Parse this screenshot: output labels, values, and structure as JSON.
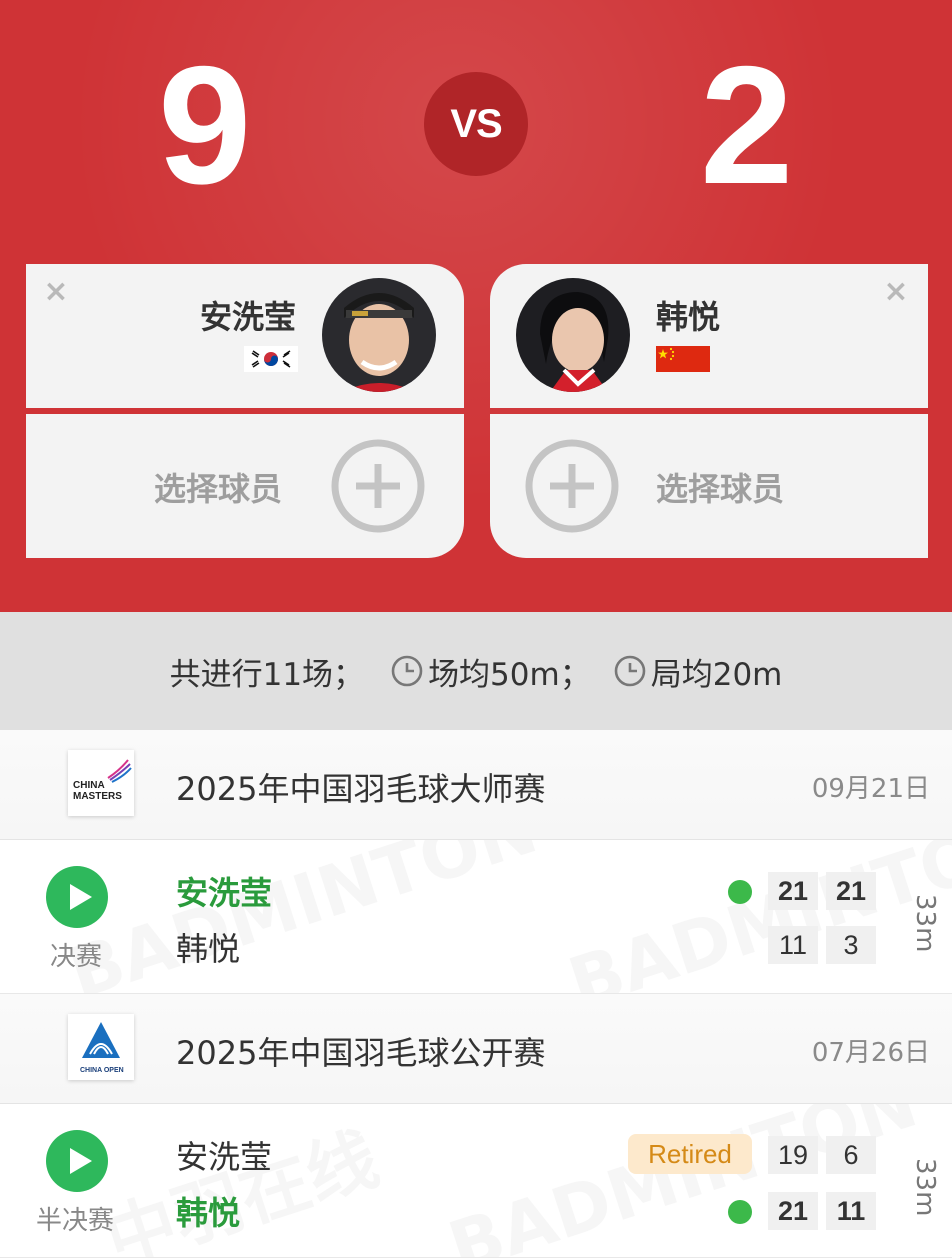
{
  "header": {
    "score_left": "9",
    "score_right": "2",
    "vs_label": "VS",
    "player1": {
      "name": "安洗莹",
      "flag": "korea-flag"
    },
    "player2": {
      "name": "韩悦",
      "flag": "china-flag"
    },
    "select_label_left": "选择球员",
    "select_label_right": "选择球员",
    "close_symbol": "×"
  },
  "stats": {
    "total": "共进行11场；",
    "avg_match": "场均50m；",
    "avg_game": "局均20m"
  },
  "events": [
    {
      "title": "2025年中国羽毛球大师赛",
      "date": "09月21日",
      "logo_text_1": "CHINA",
      "logo_text_2": "MASTERS",
      "match": {
        "round": "决赛",
        "player1": "安洗莹",
        "player2": "韩悦",
        "winner": 1,
        "scores1": [
          "21",
          "21"
        ],
        "scores2": [
          "11",
          "3"
        ],
        "duration": "33m"
      }
    },
    {
      "title": "2025年中国羽毛球公开赛",
      "date": "07月26日",
      "logo_text_1": "CHINA OPEN",
      "match": {
        "round": "半决赛",
        "player1": "安洗莹",
        "player2": "韩悦",
        "winner": 2,
        "retired_label": "Retired",
        "scores1": [
          "19",
          "6"
        ],
        "scores2": [
          "21",
          "11"
        ],
        "duration": "33m"
      }
    }
  ],
  "colors": {
    "header_red": "#cf3336",
    "winner_green": "#2a9b3c",
    "play_green": "#2eb85c",
    "retired_bg": "#fde9cc"
  }
}
